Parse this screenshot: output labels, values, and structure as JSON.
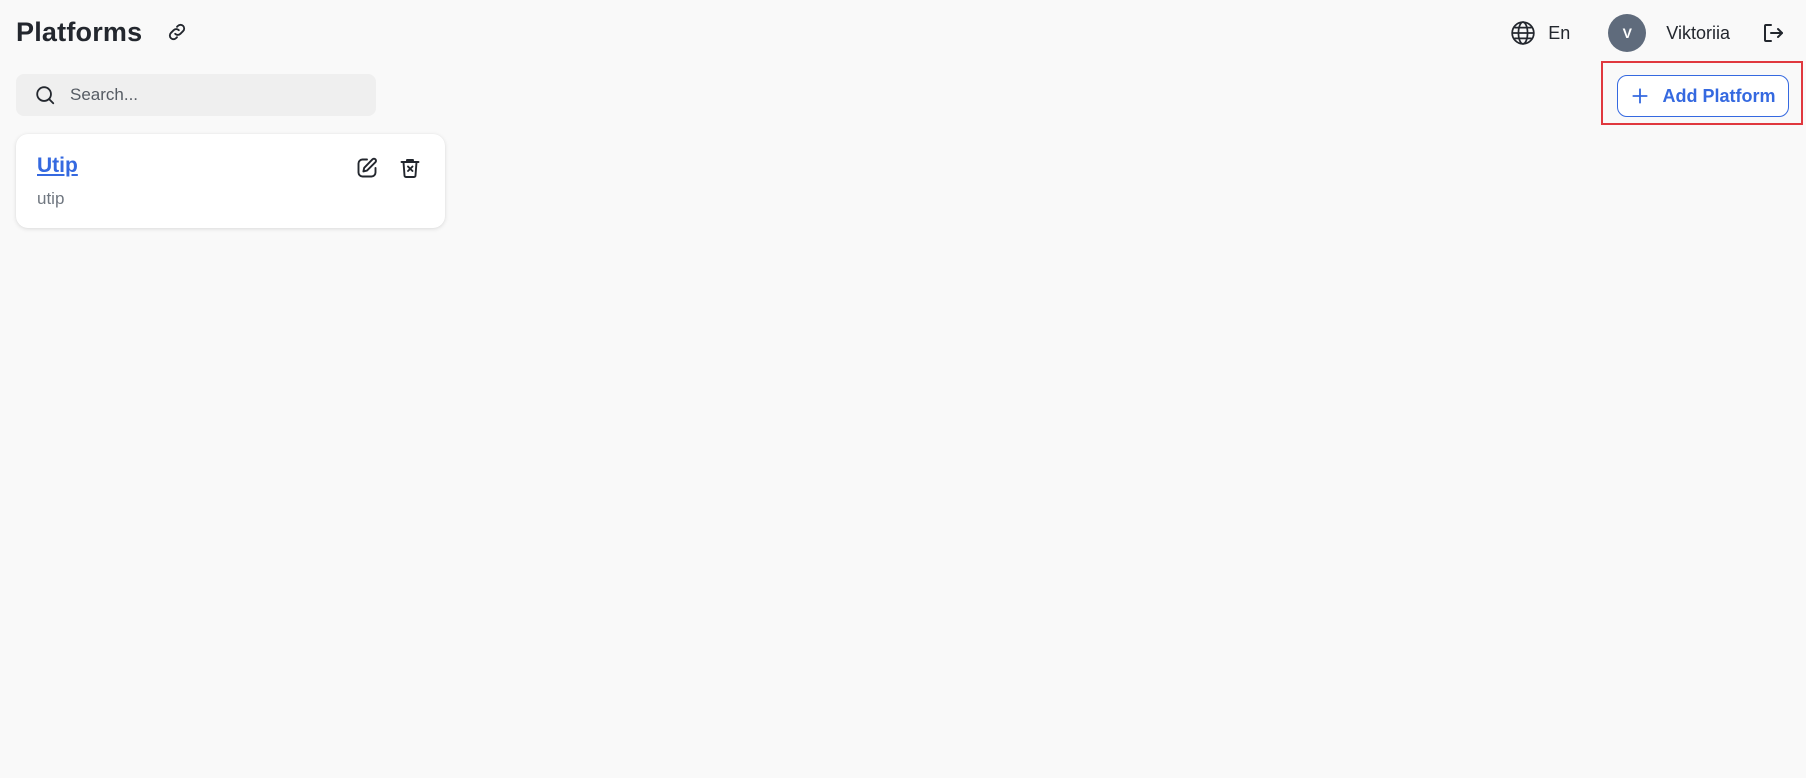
{
  "header": {
    "title": "Platforms",
    "language_label": "En",
    "user": {
      "avatar_initial": "V",
      "name": "Viktoriia"
    }
  },
  "search": {
    "placeholder": "Search...",
    "value": ""
  },
  "toolbar": {
    "add_label": "Add Platform"
  },
  "platforms": [
    {
      "name": "Utip",
      "slug": "utip"
    }
  ],
  "colors": {
    "accent": "#3569e0",
    "avatar_bg": "#5f6b7c",
    "highlight": "#e0383e",
    "background": "#f9f9f9"
  },
  "icons": {
    "title_action": "link-icon",
    "language": "globe-icon",
    "logout": "logout-icon",
    "search": "search-icon",
    "add": "plus-icon",
    "edit": "edit-icon",
    "delete": "trash-icon"
  }
}
